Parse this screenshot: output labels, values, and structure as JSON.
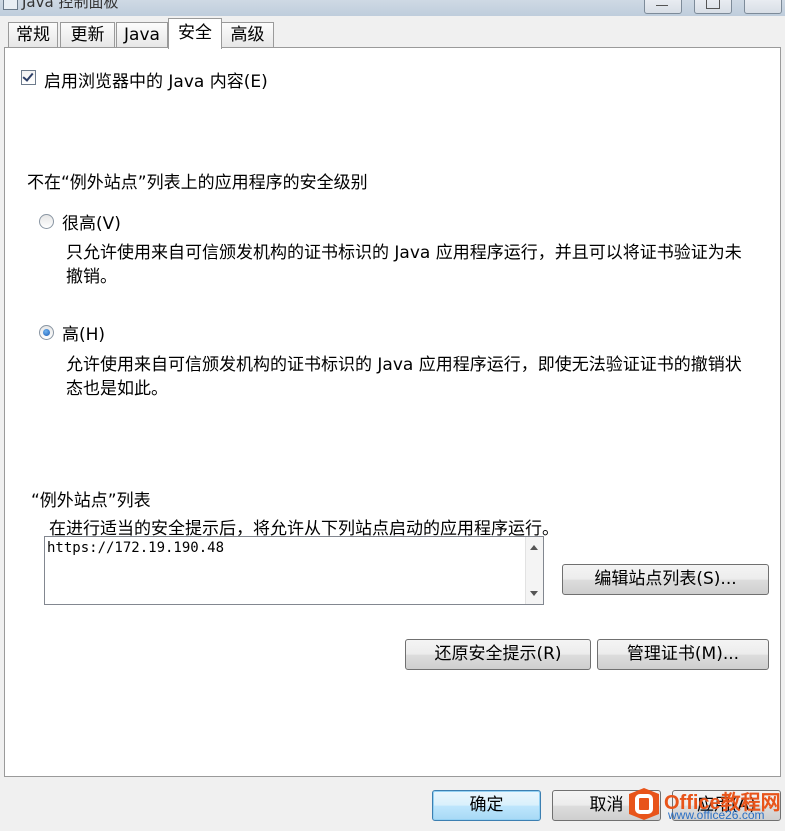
{
  "window": {
    "title": "Java 控制面板"
  },
  "tabs": [
    {
      "label": "常规"
    },
    {
      "label": "更新"
    },
    {
      "label": "Java"
    },
    {
      "label": "安全"
    },
    {
      "label": "高级"
    }
  ],
  "security": {
    "enable_checkbox": {
      "label": "启用浏览器中的 Java 内容(E)",
      "checked": true
    },
    "level_heading": "不在“例外站点”列表上的应用程序的安全级别",
    "levels": [
      {
        "label": "很高(V)",
        "selected": false,
        "description": "只允许使用来自可信颁发机构的证书标识的 Java 应用程序运行，并且可以将证书验证为未撤销。"
      },
      {
        "label": "高(H)",
        "selected": true,
        "description": "允许使用来自可信颁发机构的证书标识的 Java 应用程序运行，即使无法验证证书的撤销状态也是如此。"
      }
    ],
    "exception_heading": "“例外站点”列表",
    "exception_desc": "在进行适当的安全提示后，将允许从下列站点启动的应用程序运行。",
    "exception_sites": [
      "https://172.19.190.48"
    ],
    "edit_sites_button": "编辑站点列表(S)...",
    "restore_prompts_button": "还原安全提示(R)",
    "manage_certs_button": "管理证书(M)..."
  },
  "footer": {
    "ok_button": "确定",
    "cancel_button": "取消",
    "apply_button": "应用(A)"
  },
  "watermark": {
    "line1": "Office教程网",
    "line2": "www.office26.com"
  }
}
